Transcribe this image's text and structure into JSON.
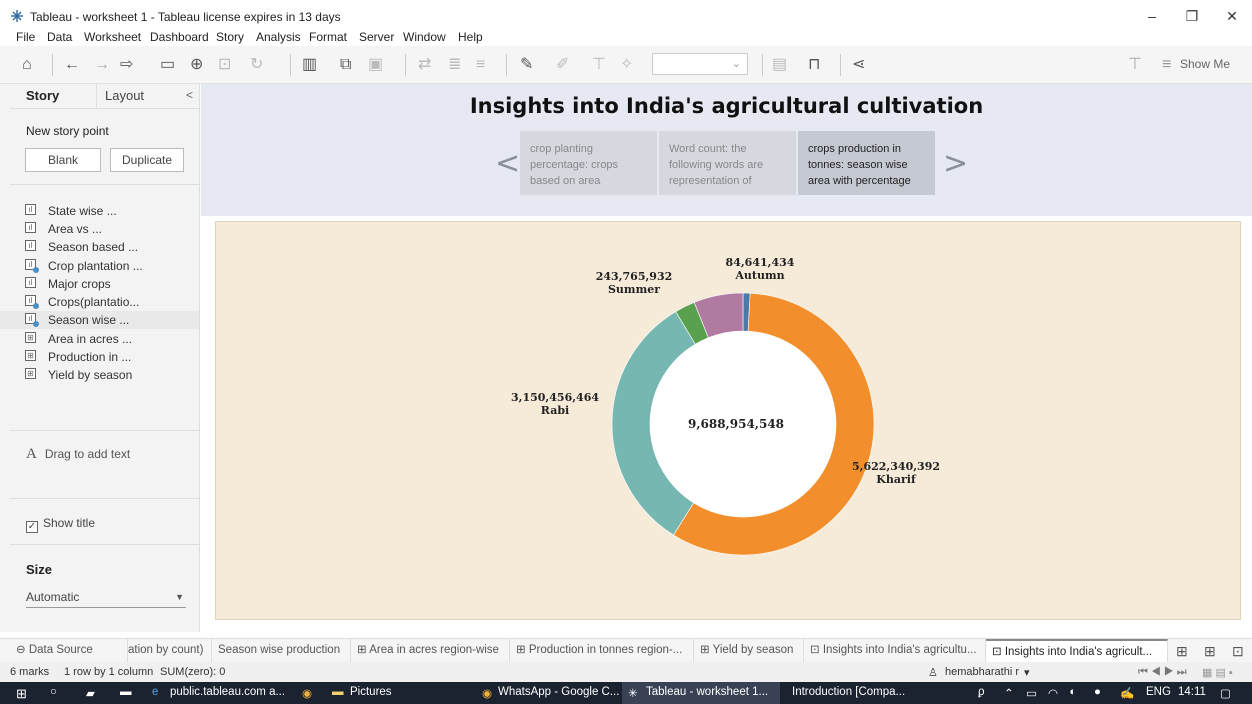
{
  "window": {
    "title": "Tableau - worksheet 1 - Tableau license expires in 13 days",
    "min": "–",
    "max": "❐",
    "close": "✕"
  },
  "menu": [
    "File",
    "Data",
    "Worksheet",
    "Dashboard",
    "Story",
    "Analysis",
    "Format",
    "Server",
    "Window",
    "Help"
  ],
  "toolbar": {
    "show_me": "Show Me"
  },
  "left_panel": {
    "tab_story": "Story",
    "tab_layout": "Layout",
    "collapse": "<",
    "new_story_point": "New story point",
    "blank_button": "Blank",
    "duplicate_button": "Duplicate",
    "sheets": [
      {
        "label": "State wise ...",
        "icon": "bar-chart-icon"
      },
      {
        "label": "Area vs ...",
        "icon": "bar-chart-icon"
      },
      {
        "label": "Season based ...",
        "icon": "bar-chart-icon"
      },
      {
        "label": "Crop plantation ...",
        "icon": "dashboard-icon"
      },
      {
        "label": "Major crops",
        "icon": "bar-chart-icon"
      },
      {
        "label": "Crops(plantatio...",
        "icon": "dashboard-icon"
      },
      {
        "label": "Season wise ...",
        "icon": "dashboard-icon"
      },
      {
        "label": "Area in acres ...",
        "icon": "table-icon"
      },
      {
        "label": "Production in ...",
        "icon": "table-icon"
      },
      {
        "label": "Yield by season",
        "icon": "table-icon"
      }
    ],
    "drag_text_icon": "A",
    "drag_text": "Drag to add text",
    "show_title": "Show title",
    "size_label": "Size",
    "size_value": "Automatic"
  },
  "story": {
    "title": "Insights into India's agricultural cultivation",
    "prev": "<",
    "next": ">",
    "points": [
      {
        "text": "crop planting percentage: crops based on area",
        "active": false
      },
      {
        "text": "Word count: the following words are representation of",
        "active": false
      },
      {
        "text": "crops production in tonnes: season wise area with percentage",
        "active": true
      }
    ]
  },
  "chart_data": {
    "type": "pie",
    "title": "",
    "donut": true,
    "total": "9,688,954,548",
    "slices": [
      {
        "label": "Autumn",
        "value": 84641434,
        "display": "84,641,434",
        "color": "#4e79a7"
      },
      {
        "label": "Kharif",
        "value": 5622340392,
        "display": "5,622,340,392",
        "color": "#f28e2b"
      },
      {
        "label": "Rabi",
        "value": 3150456464,
        "display": "3,150,456,464",
        "color": "#76b7b2"
      },
      {
        "label": "Summer",
        "value": 243765932,
        "display": "243,765,932",
        "color": "#59a14f"
      },
      {
        "label": "",
        "value": 587750326,
        "display": "",
        "color": "#b07aa1"
      }
    ]
  },
  "sheet_tabs": [
    {
      "label": "Data Source",
      "icon": "database-icon"
    },
    {
      "label": "ation by count)",
      "icon": ""
    },
    {
      "label": "Season wise production",
      "icon": ""
    },
    {
      "label": "Area in acres region-wise",
      "icon": "table-icon"
    },
    {
      "label": "Production in tonnes region-...",
      "icon": "table-icon"
    },
    {
      "label": "Yield by season",
      "icon": "table-icon"
    },
    {
      "label": "Insights into India's agricultu...",
      "icon": "story-icon"
    },
    {
      "label": "Insights into India's agricult...",
      "icon": "story-icon"
    }
  ],
  "status": {
    "marks": "6 marks",
    "rows": "1 row by 1 column",
    "sum": "SUM(zero): 0",
    "user": "hemabharathi r"
  },
  "taskbar": {
    "items": [
      "public.tableau.com a...",
      "Pictures",
      "WhatsApp - Google C...",
      "Tableau - worksheet 1...",
      "Introduction [Compa..."
    ],
    "lang": "ENG",
    "time": "14:11"
  }
}
